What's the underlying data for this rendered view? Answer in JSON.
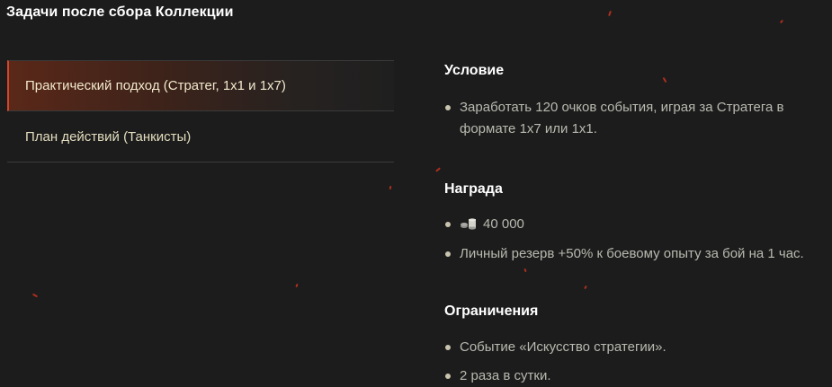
{
  "header": {
    "title": "Задачи после сбора Коллекции"
  },
  "tasks": [
    {
      "label": "Практический подход (Стратег, 1x1 и 1x7)",
      "active": true
    },
    {
      "label": "План действий (Танкисты)",
      "active": false
    }
  ],
  "condition": {
    "title": "Условие",
    "items": [
      "Заработать 120 очков события, играя за Стратега в формате 1x7 или 1x1."
    ]
  },
  "reward": {
    "title": "Награда",
    "credits_icon": "coins-icon",
    "credits_amount": "40 000",
    "items": [
      "Личный резерв +50% к боевому опыту за бой на 1 час."
    ]
  },
  "restrictions": {
    "title": "Ограничения",
    "items": [
      "Событие «Искусство стратегии».",
      "2 раза в сутки."
    ]
  },
  "colors": {
    "background": "#1c1c1c",
    "accent": "#d2462a",
    "text_primary": "#ffffff",
    "text_secondary": "#b9b9b1",
    "task_text": "#e4ddbf"
  }
}
